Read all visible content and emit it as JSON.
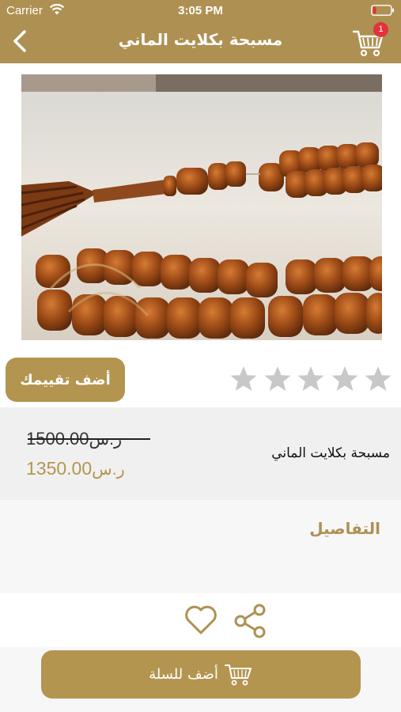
{
  "status_bar": {
    "carrier": "Carrier",
    "time": "3:05 PM",
    "icons": [
      "wifi-icon",
      "battery-icon"
    ]
  },
  "nav": {
    "title": "مسبحة بكلايت الماني",
    "back_icon": "chevron-left-icon",
    "cart_icon": "cart-icon",
    "cart_badge": "1"
  },
  "product": {
    "name": "مسبحة بكلايت الماني",
    "old_price": "1500.00",
    "new_price": "1350.00",
    "currency": "ر.س",
    "image_icon": "prayer-beads-photo"
  },
  "rating": {
    "button_label": "أضف تقييمك",
    "value": 0,
    "max": 5
  },
  "details": {
    "title": "التفاصيل"
  },
  "actions": {
    "favorite_icon": "heart-icon",
    "share_icon": "share-icon",
    "add_to_cart_label": "أضف للسلة",
    "add_to_cart_icon": "cart-icon"
  },
  "colors": {
    "brand_gold": "#ae9152",
    "button_gold": "#b39550",
    "badge_red": "#e2323b",
    "star_gray": "#c8c8c8",
    "section_gray": "#f0f0f0"
  }
}
